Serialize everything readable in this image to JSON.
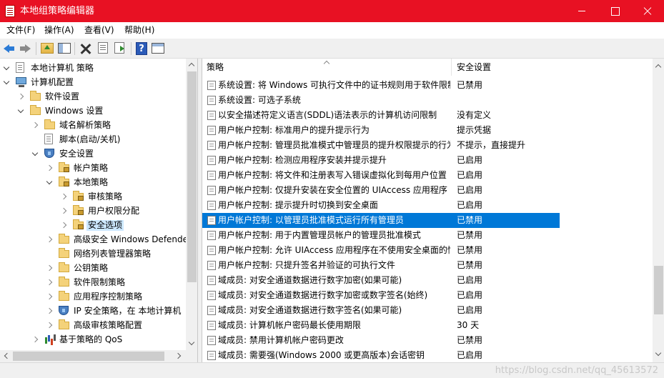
{
  "window": {
    "title": "本地组策略编辑器",
    "accent": "#e81123"
  },
  "menu": [
    "文件(F)",
    "操作(A)",
    "查看(V)",
    "帮助(H)"
  ],
  "toolbar": {
    "help_label": "?"
  },
  "tree": {
    "items": [
      {
        "label": "本地计算机 策略",
        "icon": "doc-icon"
      },
      {
        "label": "计算机配置",
        "icon": "computer-icon"
      },
      {
        "label": "软件设置",
        "icon": "folder-icon"
      },
      {
        "label": "Windows 设置",
        "icon": "folder-icon"
      },
      {
        "label": "域名解析策略",
        "icon": "folder-icon"
      },
      {
        "label": "脚本(启动/关机)",
        "icon": "doc-icon"
      },
      {
        "label": "安全设置",
        "icon": "shield-icon"
      },
      {
        "label": "帐户策略",
        "icon": "lock-folder-icon"
      },
      {
        "label": "本地策略",
        "icon": "lock-folder-icon"
      },
      {
        "label": "审核策略",
        "icon": "lock-folder-icon"
      },
      {
        "label": "用户权限分配",
        "icon": "lock-folder-icon"
      },
      {
        "label": "安全选项",
        "icon": "lock-folder-icon"
      },
      {
        "label": "高级安全 Windows Defender",
        "icon": "folder-icon"
      },
      {
        "label": "网络列表管理器策略",
        "icon": "folder-icon"
      },
      {
        "label": "公钥策略",
        "icon": "folder-icon"
      },
      {
        "label": "软件限制策略",
        "icon": "folder-icon"
      },
      {
        "label": "应用程序控制策略",
        "icon": "folder-icon"
      },
      {
        "label": "IP 安全策略，在 本地计算机",
        "icon": "shield-icon"
      },
      {
        "label": "高级审核策略配置",
        "icon": "folder-icon"
      },
      {
        "label": "基于策略的 QoS",
        "icon": "chart-icon"
      }
    ]
  },
  "list": {
    "headers": {
      "policy": "策略",
      "setting": "安全设置"
    },
    "rows": [
      {
        "policy": "系统设置: 将 Windows 可执行文件中的证书规则用于软件限制策略",
        "setting": "已禁用"
      },
      {
        "policy": "系统设置: 可选子系统",
        "setting": ""
      },
      {
        "policy": "以安全描述符定义语言(SDDL)语法表示的计算机访问限制",
        "setting": "没有定义"
      },
      {
        "policy": "用户帐户控制: 标准用户的提升提示行为",
        "setting": "提示凭据"
      },
      {
        "policy": "用户帐户控制: 管理员批准模式中管理员的提升权限提示的行为",
        "setting": "不提示，直接提升"
      },
      {
        "policy": "用户帐户控制: 检测应用程序安装并提示提升",
        "setting": "已启用"
      },
      {
        "policy": "用户帐户控制: 将文件和注册表写入错误虚拟化到每用户位置",
        "setting": "已启用"
      },
      {
        "policy": "用户帐户控制: 仅提升安装在安全位置的 UIAccess 应用程序",
        "setting": "已启用"
      },
      {
        "policy": "用户帐户控制: 提示提升时切换到安全桌面",
        "setting": "已启用"
      },
      {
        "policy": "用户帐户控制: 以管理员批准模式运行所有管理员",
        "setting": "已禁用"
      },
      {
        "policy": "用户帐户控制: 用于内置管理员帐户的管理员批准模式",
        "setting": "已禁用"
      },
      {
        "policy": "用户帐户控制: 允许 UIAccess 应用程序在不使用安全桌面的情况下提升权限",
        "setting": "已禁用"
      },
      {
        "policy": "用户帐户控制: 只提升签名并验证的可执行文件",
        "setting": "已禁用"
      },
      {
        "policy": "域成员: 对安全通道数据进行数字加密(如果可能)",
        "setting": "已启用"
      },
      {
        "policy": "域成员: 对安全通道数据进行数字加密或数字签名(始终)",
        "setting": "已启用"
      },
      {
        "policy": "域成员: 对安全通道数据进行数字签名(如果可能)",
        "setting": "已启用"
      },
      {
        "policy": "域成员: 计算机帐户密码最长使用期限",
        "setting": "30 天"
      },
      {
        "policy": "域成员: 禁用计算机帐户密码更改",
        "setting": "已禁用"
      },
      {
        "policy": "域成员: 需要强(Windows 2000 或更高版本)会话密钥",
        "setting": "已启用"
      }
    ]
  },
  "watermark": "https://blog.csdn.net/qq_45613572"
}
